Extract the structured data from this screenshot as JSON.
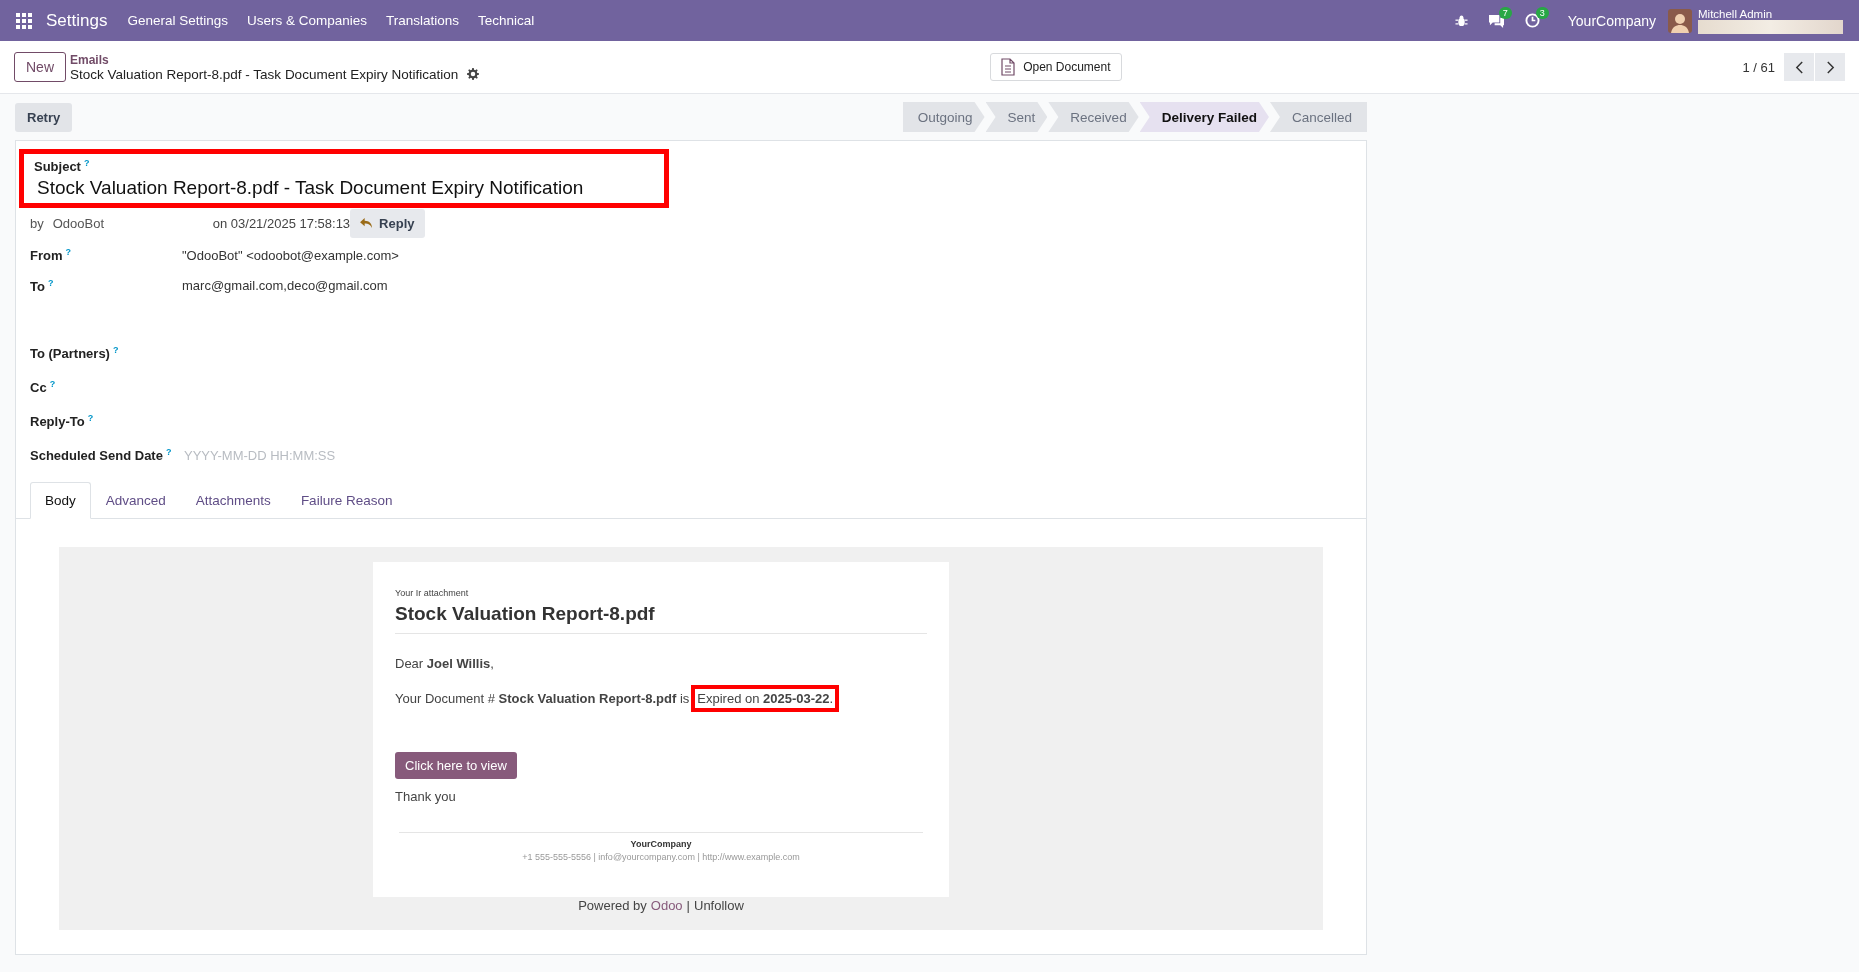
{
  "topbar": {
    "app": "Settings",
    "menu": [
      "General Settings",
      "Users & Companies",
      "Translations",
      "Technical"
    ],
    "chat_count": "7",
    "activity_count": "3",
    "company": "YourCompany",
    "user": "Mitchell Admin"
  },
  "control_panel": {
    "new_button": "New",
    "breadcrumb": "Emails",
    "title": "Stock Valuation Report-8.pdf - Task Document Expiry Notification",
    "open_document": "Open Document",
    "pager": "1 / 61"
  },
  "retry": "Retry",
  "stages": [
    {
      "label": "Outgoing",
      "selected": false
    },
    {
      "label": "Sent",
      "selected": false
    },
    {
      "label": "Received",
      "selected": false
    },
    {
      "label": "Delivery Failed",
      "selected": true
    },
    {
      "label": "Cancelled",
      "selected": false
    }
  ],
  "form": {
    "subject_label": "Subject",
    "subject_help": "?",
    "subject": "Stock Valuation Report-8.pdf - Task Document Expiry Notification",
    "subject_highlighted": true,
    "author_prefix": "by",
    "author": "OdooBot",
    "date": "on 03/21/2025 17:58:13",
    "reply": "Reply",
    "fields": [
      {
        "label": "From",
        "help": "?",
        "value": "\"OdooBot\" <odoobot@example.com>"
      },
      {
        "label": "To",
        "help": "?",
        "value": "marc@gmail.com,deco@gmail.com"
      },
      {
        "label": "To (Partners)",
        "help": "?"
      },
      {
        "label": "Cc",
        "help": "?"
      },
      {
        "label": "Reply-To",
        "help": "?"
      },
      {
        "label": "Scheduled Send Date",
        "help": "?",
        "placeholder": "YYYY-MM-DD HH:MM:SS"
      }
    ],
    "tabs": [
      {
        "label": "Body",
        "selected": true
      },
      {
        "label": "Advanced",
        "selected": false
      },
      {
        "label": "Attachments",
        "selected": false
      },
      {
        "label": "Failure Reason",
        "selected": false
      }
    ]
  },
  "email": {
    "kicker": "Your Ir attachment",
    "heading": "Stock Valuation Report-8.pdf",
    "greeting": "Dear **Joel Willis**,",
    "message": "Your Document # **Stock Valuation Report-8.pdf** is",
    "expiry": "Expired on **2025-03-22**.",
    "expiry_highlighted": true,
    "button": "Click here to view",
    "closing": "Thank you",
    "company": "YourCompany",
    "contact": "+1 555-555-5556 | info@yourcompany.com | http://www.example.com",
    "powered_prefix": "Powered by",
    "powered_link": "Odoo",
    "separator": "|",
    "unfollow": "Unfollow"
  }
}
